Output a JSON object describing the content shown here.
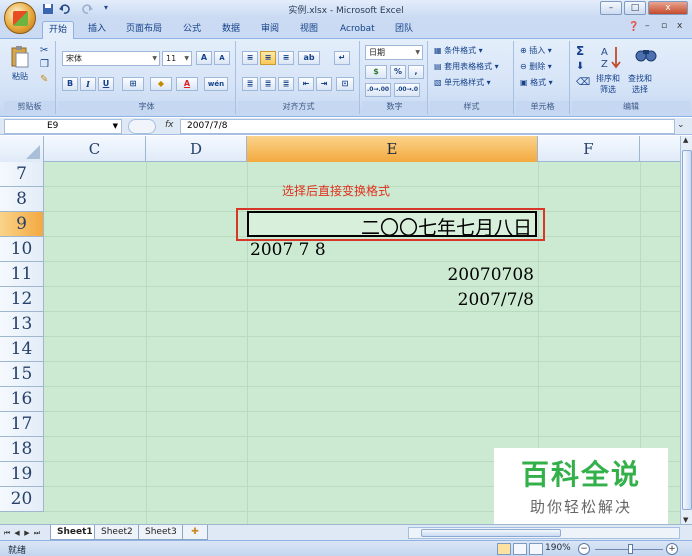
{
  "window": {
    "title": "实例.xlsx - Microsoft Excel",
    "minimize": "–",
    "maximize": "□",
    "close": "x"
  },
  "tabs": [
    "开始",
    "插入",
    "页面布局",
    "公式",
    "数据",
    "审阅",
    "视图",
    "Acrobat",
    "团队"
  ],
  "ribbon": {
    "clipboard": {
      "label": "剪贴板",
      "paste": "粘贴"
    },
    "font": {
      "label": "字体",
      "font_name": "宋体",
      "font_size": "11",
      "bold": "B",
      "italic": "I",
      "underline": "U",
      "grow": "A",
      "shrink": "A",
      "font_color": "A",
      "phonetic": "wén"
    },
    "alignment": {
      "label": "对齐方式"
    },
    "number": {
      "label": "数字",
      "format": "日期",
      "percent": "%",
      "comma": ",",
      "currency": "$"
    },
    "styles": {
      "label": "样式",
      "conditional": "条件格式",
      "table": "套用表格格式",
      "cell_styles": "单元格样式"
    },
    "cells": {
      "label": "单元格",
      "insert": "插入",
      "delete": "删除",
      "format": "格式"
    },
    "editing": {
      "label": "编辑",
      "sum": "Σ",
      "sort": "排序和\n筛选",
      "find": "查找和\n选择"
    }
  },
  "formula_bar": {
    "name_box": "E9",
    "fx": "fx",
    "formula": "2007/7/8"
  },
  "columns": [
    "C",
    "D",
    "E",
    "F"
  ],
  "selected_column": "E",
  "rows": [
    "7",
    "8",
    "9",
    "10",
    "11",
    "12",
    "13",
    "14",
    "15",
    "16",
    "17",
    "18",
    "19",
    "20"
  ],
  "selected_row": "9",
  "cells": {
    "note": "选择后直接变换格式",
    "e9": "二〇〇七年七月八日",
    "e10": "2007  7  8",
    "e11": "20070708",
    "e12": "2007/7/8"
  },
  "colors": {
    "highlight_red": "#d9362a",
    "sheet_background": "#ccead1",
    "selected_header": "#f3a93f"
  },
  "watermark": {
    "title": "百科全说",
    "subtitle": "助你轻松解决"
  },
  "sheets": [
    "Sheet1",
    "Sheet2",
    "Sheet3"
  ],
  "active_sheet": "Sheet1",
  "status": {
    "mode": "就绪",
    "zoom": "190%"
  }
}
